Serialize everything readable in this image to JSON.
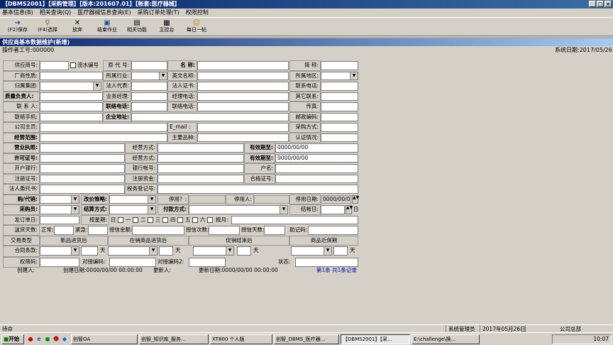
{
  "window": {
    "title": "【DBMS2001】【采购管理】【版本:201607.01】【帐套:医疗器械】",
    "btn_min": "_",
    "btn_max": "□",
    "btn_close": "×"
  },
  "menu": [
    "基本信息(B)",
    "相关查询(Q)",
    "医疗器械信息查询(E)",
    "采购订单处理(T)",
    "权限控制"
  ],
  "toolbar": [
    {
      "name": "save",
      "icon": "💾",
      "label": "(F2)保存"
    },
    {
      "name": "select",
      "icon": "🔎",
      "label": "(F4)选择"
    },
    {
      "name": "discard",
      "icon": "✕",
      "label": "放弃"
    },
    {
      "name": "end-job",
      "icon": "▣",
      "label": "结束作业"
    },
    {
      "name": "related",
      "icon": "▤",
      "label": "相关功能"
    },
    {
      "name": "console",
      "icon": "▦",
      "label": "主控台"
    },
    {
      "name": "daily-tip",
      "icon": "☺",
      "label": "每日一帖"
    }
  ],
  "child": {
    "title": "供应商基本数据维护(新增)",
    "operator": "操作者工号:000000",
    "sysdate": "系统日期:2017/05/26"
  },
  "labels": {
    "supplier_no": "供应商号:",
    "serial_no": "流水编号",
    "orig_code": "原 代 号:",
    "name": "名    称:",
    "short": "简    称:",
    "factory_type": "厂商性质:",
    "industry": "所属行业:",
    "eng_name": "英文名称:",
    "region": "所属地区:",
    "group": "归属集团:",
    "legal_rep": "法人代表:",
    "legal_cert": "法人证书:",
    "contact_phone": "联系电话:",
    "quality_mgr": "质量负责人:",
    "biz_mgr": "业务经理:",
    "mgr_phone": "经理电话:",
    "other_contact": "其它联系:",
    "contact_person": "联 系 人:",
    "contact_tel": "联络电话:",
    "contact_tel2": "联络电话:",
    "fax": "传真:",
    "contact_mobile": "联络手机:",
    "company_addr": "企业地址:",
    "zipcode": "邮政编码:",
    "homepage": "公司主页:",
    "email": "E_mail  :",
    "purchase_mode": "采购方式:",
    "biz_scope": "经营范围:",
    "main_product": "主要品种:",
    "cert_status": "认证情况:",
    "biz_license": "营业执照:",
    "biz_mode1": "经营方式:",
    "valid_to1": "有效期至:",
    "permit_no": "许可证号:",
    "biz_mode2": "经营方式:",
    "valid_to2": "有效期至:",
    "bank": "开户银行:",
    "bank_acct": "银行帐号:",
    "acct_name": "户名:",
    "reg_cert": "注册证号:",
    "reg_capital": "注册资金:",
    "qual_cert": "合格证号:",
    "legal_auth": "法人委托书:",
    "tax_reg": "税务登记号:",
    "buy_sell": "购/代销:",
    "price_strategy": "改价策略:",
    "deactivate": "停用？:",
    "deactivated_by": "停用人:",
    "deactivate_date": "停用日期:",
    "buyer": "采购员:",
    "settle_type": "结算方式:",
    "pay_mode": "付款方式:",
    "settle_date": "结帐日:",
    "day": "日",
    "order_day": "发订单日:",
    "weekday": "按星期:",
    "mon": "一",
    "tue": "二",
    "wed": "三",
    "thu": "四",
    "fri": "五",
    "sat": "六",
    "by_month": "按月:",
    "deliver_days": "送货天数:",
    "normal": "正常:",
    "urgent": "紧急:",
    "credit_amt": "授信金额:",
    "credit_times": "授信次数:",
    "credit_days": "授信天数:",
    "memo_code": "助记码:",
    "trade_type": "交易类型",
    "new_product": "新品进货后",
    "on_sale": "在销商品进货后",
    "promo_end": "促销结束后",
    "near_expiry": "商品近保期",
    "contract_terms": "合同条款:",
    "days1": "天",
    "days2": "天",
    "days3": "天",
    "days4": "天",
    "right_code": "权限码:",
    "docking_code": "对接编码:",
    "docking_code2": "对接编码2:",
    "status": "状态:"
  },
  "values": {
    "date_empty": "0000/00/00"
  },
  "footer": {
    "creator": "创建人:",
    "created": "创建日期:0000/00/00 00:00:00",
    "updater": "更新人:",
    "updated": "更新日期:0000/00/00 00:00:00",
    "records": "第1条 共1条记录"
  },
  "statusbar": {
    "left": "待命",
    "user": "系统管理员",
    "date": "2017年05月26日",
    "company": "公司总部"
  },
  "taskbar": {
    "start": "开始",
    "tasks": [
      "创智OA",
      "创智_知识库_服务...",
      "XT800 个人版",
      "创智_DBMS_医疗器...",
      "【DBMS2001】【采...",
      "E:\\challenge\\换..."
    ],
    "clock": "10:07"
  }
}
